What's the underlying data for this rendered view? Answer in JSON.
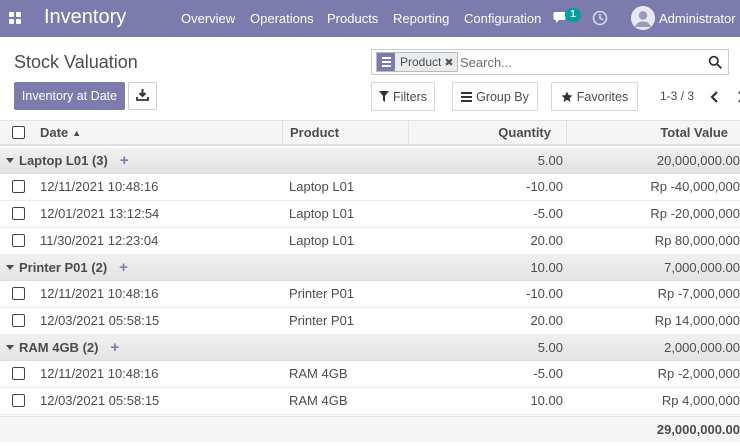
{
  "navbar": {
    "brand": "Inventory",
    "menu": [
      "Overview",
      "Operations",
      "Products",
      "Reporting",
      "Configuration"
    ],
    "chat_badge": "1",
    "user": "Administrator"
  },
  "control_panel": {
    "title": "Stock Valuation",
    "search": {
      "facet_label": "Product",
      "placeholder": "Search..."
    },
    "inventory_at_date_label": "Inventory at Date",
    "filters_label": "Filters",
    "group_by_label": "Group By",
    "favorites_label": "Favorites",
    "pager": "1-3 / 3"
  },
  "table": {
    "headers": {
      "date": "Date",
      "product": "Product",
      "quantity": "Quantity",
      "total_value": "Total Value"
    },
    "sort_indicator": "▲",
    "groups": [
      {
        "label": "Laptop L01",
        "count": "(3)",
        "quantity": "5.00",
        "total_value": "20,000,000.00",
        "rows": [
          {
            "date": "12/11/2021 10:48:16",
            "product": "Laptop L01",
            "quantity": "-10.00",
            "total_value": "Rp -40,000,000"
          },
          {
            "date": "12/01/2021 13:12:54",
            "product": "Laptop L01",
            "quantity": "-5.00",
            "total_value": "Rp -20,000,000"
          },
          {
            "date": "11/30/2021 12:23:04",
            "product": "Laptop L01",
            "quantity": "20.00",
            "total_value": "Rp 80,000,000"
          }
        ]
      },
      {
        "label": "Printer P01",
        "count": "(2)",
        "quantity": "10.00",
        "total_value": "7,000,000.00",
        "rows": [
          {
            "date": "12/11/2021 10:48:16",
            "product": "Printer P01",
            "quantity": "-10.00",
            "total_value": "Rp -7,000,000"
          },
          {
            "date": "12/03/2021 05:58:15",
            "product": "Printer P01",
            "quantity": "20.00",
            "total_value": "Rp 14,000,000"
          }
        ]
      },
      {
        "label": "RAM 4GB",
        "count": "(2)",
        "quantity": "5.00",
        "total_value": "2,000,000.00",
        "rows": [
          {
            "date": "12/11/2021 10:48:16",
            "product": "RAM 4GB",
            "quantity": "-5.00",
            "total_value": "Rp -2,000,000"
          },
          {
            "date": "12/03/2021 05:58:15",
            "product": "RAM 4GB",
            "quantity": "10.00",
            "total_value": "Rp 4,000,000"
          }
        ]
      }
    ],
    "footer_total": "29,000,000.00"
  },
  "colors": {
    "brand": "#7c7bad",
    "badge": "#00a09d"
  }
}
